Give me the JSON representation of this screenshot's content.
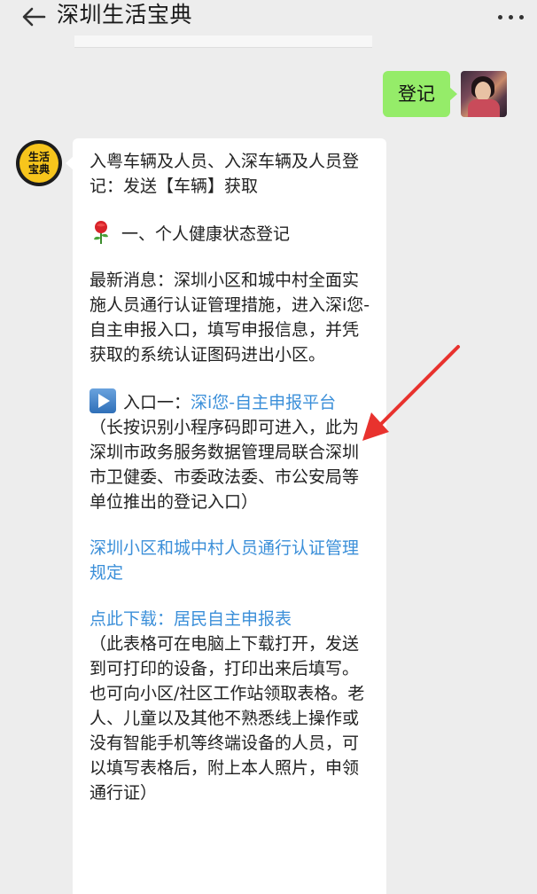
{
  "header": {
    "title": "深圳生活宝典",
    "back_icon": "arrow-left-icon",
    "more_icon": "more-dots-icon"
  },
  "sent_message": {
    "text": "登记"
  },
  "bot": {
    "avatar_line1": "生活",
    "avatar_line2": "宝典",
    "avatar_color": "#f7c51c"
  },
  "reply": {
    "intro": "入粤车辆及人员、入深车辆及人员登记：发送【车辆】获取",
    "section1": "一、个人健康状态登记",
    "news": "最新消息：深圳小区和城中村全面实施人员通行认证管理措施，进入深i您-自主申报入口，填写申报信息，并凭获取的系统认证图码进出小区。",
    "entry_label": "入口一：",
    "entry_link": "深i您-自主申报平台",
    "entry_note": "（长按识别小程序码即可进入，此为深圳市政务服务数据管理局联合深圳市卫健委、市委政法委、市公安局等单位推出的登记入口）",
    "rule_link": "深圳小区和城中村人员通行认证管理规定",
    "download_link": "点此下载：居民自主申报表",
    "download_note": "（此表格可在电脑上下载打开，发送到可打印的设备，打印出来后填写。也可向小区/社区工作站领取表格。老人、儿童以及其他不熟悉线上操作或没有智能手机等终端设备的人员，可以填写表格后，附上本人照片，申领通行证）"
  },
  "colors": {
    "background": "#ededed",
    "sent_bubble": "#95ec69",
    "link": "#3b8fd9",
    "annotation_arrow": "#e8322e"
  }
}
